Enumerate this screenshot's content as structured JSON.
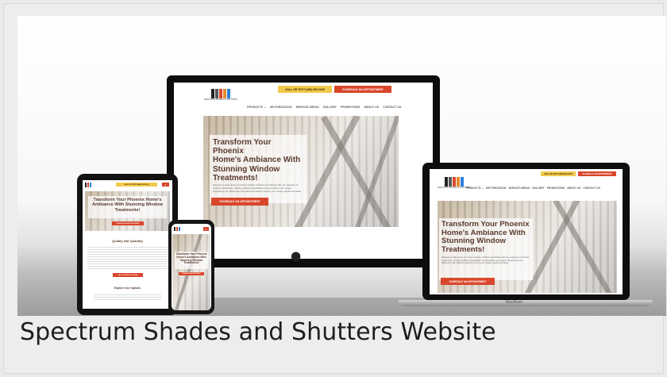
{
  "caption": "Spectrum Shades and Shutters Website",
  "site": {
    "call_button": "CALL OR TEXT (480) 000-0000",
    "schedule_button": "SCHEDULE AN APPOINTMENT",
    "logo_caption": "SPECTRUM SHADES & SHUTTERS",
    "nav": [
      "PRODUCTS ⌄",
      "MOTORIZATION",
      "SERVICE AREAS",
      "GALLERY",
      "PROMOTIONS",
      "ABOUT US",
      "CONTACT US"
    ],
    "hero_title_lines": [
      "Transform Your Phoenix",
      "Home's Ambiance With",
      "Stunning Window",
      "Treatments!"
    ],
    "hero_body": "Discover a wide array of custom shades, shutters and blinds with our selection of window treatments, offering endless possibilities to personalize your space. Experience the difference with tailored solutions that fit your unique needs and taste.",
    "cta": "SCHEDULE AN APPOINTMENT",
    "tablet_hero_title": "Transform Your Phoenix Home's Ambiance With Stunning Window Treatments!",
    "tablet_section_title": "Quality Not Quantity",
    "tablet_section2_title": "Explore Our Options",
    "tablet_cta2": "CALL OR TEXT US TODAY",
    "phone_hero_title": "Transform Your Phoenix Home's Ambiance With Stunning Window Treatments!"
  },
  "macbook_label": "MacBook",
  "colors": {
    "accent_red": "#d9462b",
    "accent_yellow": "#f2c94c",
    "heading_brown": "#5a3a2e"
  }
}
